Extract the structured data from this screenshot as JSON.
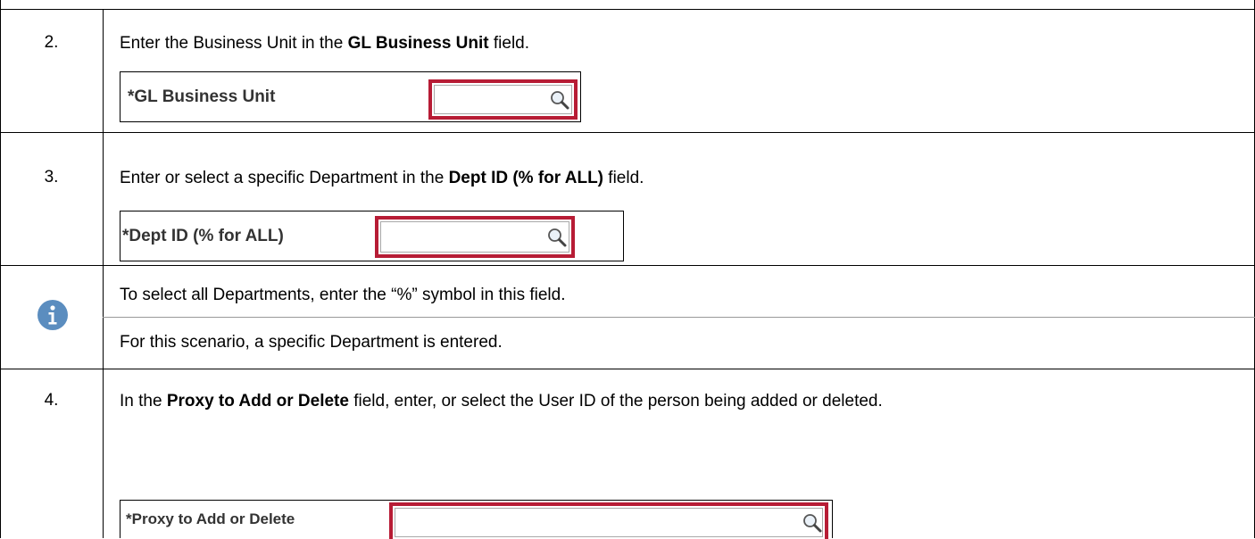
{
  "steps": [
    {
      "number": "2.",
      "text_before": "Enter the Business Unit in the ",
      "text_bold": "GL Business Unit",
      "text_after": " field.",
      "snippet": {
        "label": "*GL Business Unit",
        "field_value": "",
        "icon": "magnifier-icon"
      }
    },
    {
      "number": "3.",
      "text_before": "Enter or select a specific Department in the ",
      "text_bold": "Dept ID (% for ALL)",
      "text_after": " field.",
      "snippet": {
        "label": "*Dept ID (% for ALL)",
        "field_value": "",
        "icon": "magnifier-icon"
      }
    },
    {
      "number": "4.",
      "text_before": "In the ",
      "text_bold": "Proxy to Add or Delete",
      "text_after": " field, enter, or select the User ID of the person being added or deleted.",
      "snippet": {
        "label": "*Proxy to Add or Delete",
        "field_value": "",
        "icon": "magnifier-icon"
      }
    }
  ],
  "info_note": {
    "icon": "info-icon",
    "line1": "To select all Departments, enter the “%” symbol in this field.",
    "line2": "For this scenario, a specific Department is entered."
  },
  "colors": {
    "highlight": "#b71c35",
    "info_icon": "#5b8dbf"
  }
}
